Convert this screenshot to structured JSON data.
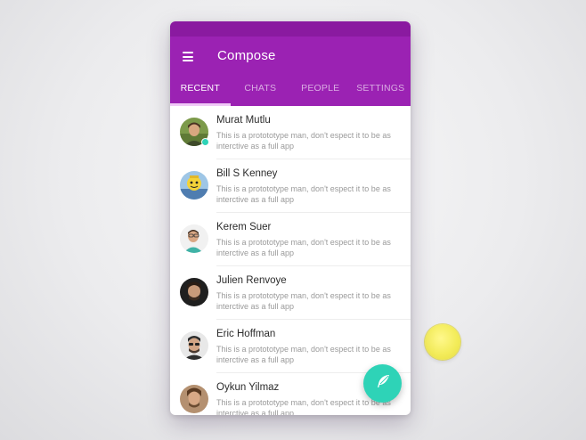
{
  "app": {
    "title": "Compose"
  },
  "tabs": [
    {
      "label": "RECENT",
      "active": true
    },
    {
      "label": "CHATS",
      "active": false
    },
    {
      "label": "PEOPLE",
      "active": false
    },
    {
      "label": "SETTINGS",
      "active": false
    }
  ],
  "chats": [
    {
      "name": "Murat Mutlu",
      "message": "This is a protototype man, don't espect it to be as interctive as a full app",
      "online": true
    },
    {
      "name": "Bill S Kenney",
      "message": "This is a protototype man, don't espect it to be as interctive as a full app",
      "online": false
    },
    {
      "name": "Kerem Suer",
      "message": "This is a protototype man, don't espect it to be as interctive as a full app",
      "online": false
    },
    {
      "name": "Julien Renvoye",
      "message": "This is a protototype man, don't espect it to be as interctive as a full app",
      "online": false
    },
    {
      "name": "Eric Hoffman",
      "message": "This is a protototype man, don't espect it to be as interctive as a full app",
      "online": false
    },
    {
      "name": "Oykun Yilmaz",
      "message": "This is a protototype man, don't espect it to be as interctive as a full app",
      "online": false
    }
  ],
  "icons": {
    "menu": "hamburger-menu-icon",
    "compose": "feather-icon"
  },
  "colors": {
    "primary": "#9b22b3",
    "primary_dark": "#8a1aa0",
    "tab_indicator": "#f0c9f7",
    "fab": "#2ed3b7",
    "online": "#2ed3b7",
    "touch_indicator": "#f3ec5a"
  }
}
